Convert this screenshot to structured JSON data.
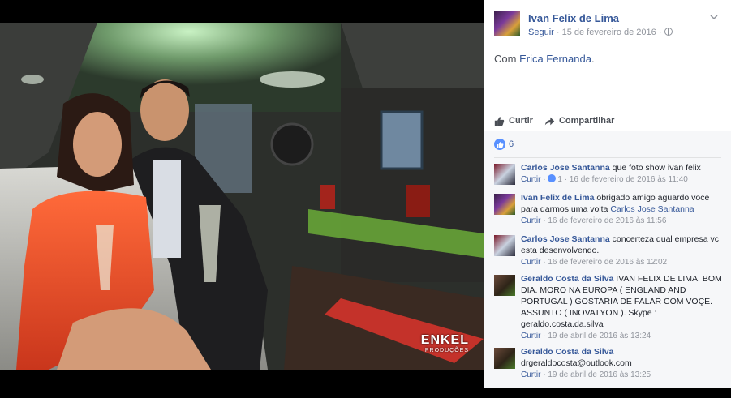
{
  "post": {
    "author": "Ivan Felix de Lima",
    "follow_label": "Seguir",
    "separator": " · ",
    "date": "15 de fevereiro de 2016",
    "privacy_separator": " · ",
    "text_prefix": "Com ",
    "tagged": "Erica Fernanda",
    "text_suffix": "."
  },
  "actions": {
    "like_label": "Curtir",
    "share_label": "Compartilhar"
  },
  "reactions": {
    "count": "6"
  },
  "photo": {
    "watermark": "ENKEL",
    "watermark_sub": "PRODUÇÕES"
  },
  "comments": [
    {
      "author": "Carlos Jose Santanna",
      "text": " que foto show ivan felix",
      "reply": "Curtir",
      "likes": "1",
      "date": "16 de fevereiro de 2016 às 11:40"
    },
    {
      "author": "Ivan Felix de Lima",
      "text": " obrigado amigo aguardo voce para darmos uma volta ",
      "mention": "Carlos Jose Santanna",
      "reply": "Curtir",
      "date": "16 de fevereiro de 2016 às 11:56"
    },
    {
      "author": "Carlos Jose Santanna",
      "text": " concerteza qual empresa vc esta desenvolvendo.",
      "reply": "Curtir",
      "date": "16 de fevereiro de 2016 às 12:02"
    },
    {
      "author": "Geraldo Costa da Silva",
      "text": " IVAN FELIX DE LIMA. BOM DIA. MORO NA EUROPA ( ENGLAND AND PORTUGAL ) GOSTARIA DE FALAR COM VOÇE. ASSUNTO ( INOVATYON ). Skype : geraldo.costa.da.silva",
      "reply": "Curtir",
      "date": "19 de abril de 2016 às 13:24"
    },
    {
      "author": "Geraldo Costa da Silva",
      "text": "drgeraldocosta@outlook.com",
      "reply": "Curtir",
      "date": "19 de abril de 2016 às 13:25"
    }
  ],
  "colors": {
    "link": "#365899",
    "meta": "#90949c",
    "like_blue": "#5890ff"
  }
}
